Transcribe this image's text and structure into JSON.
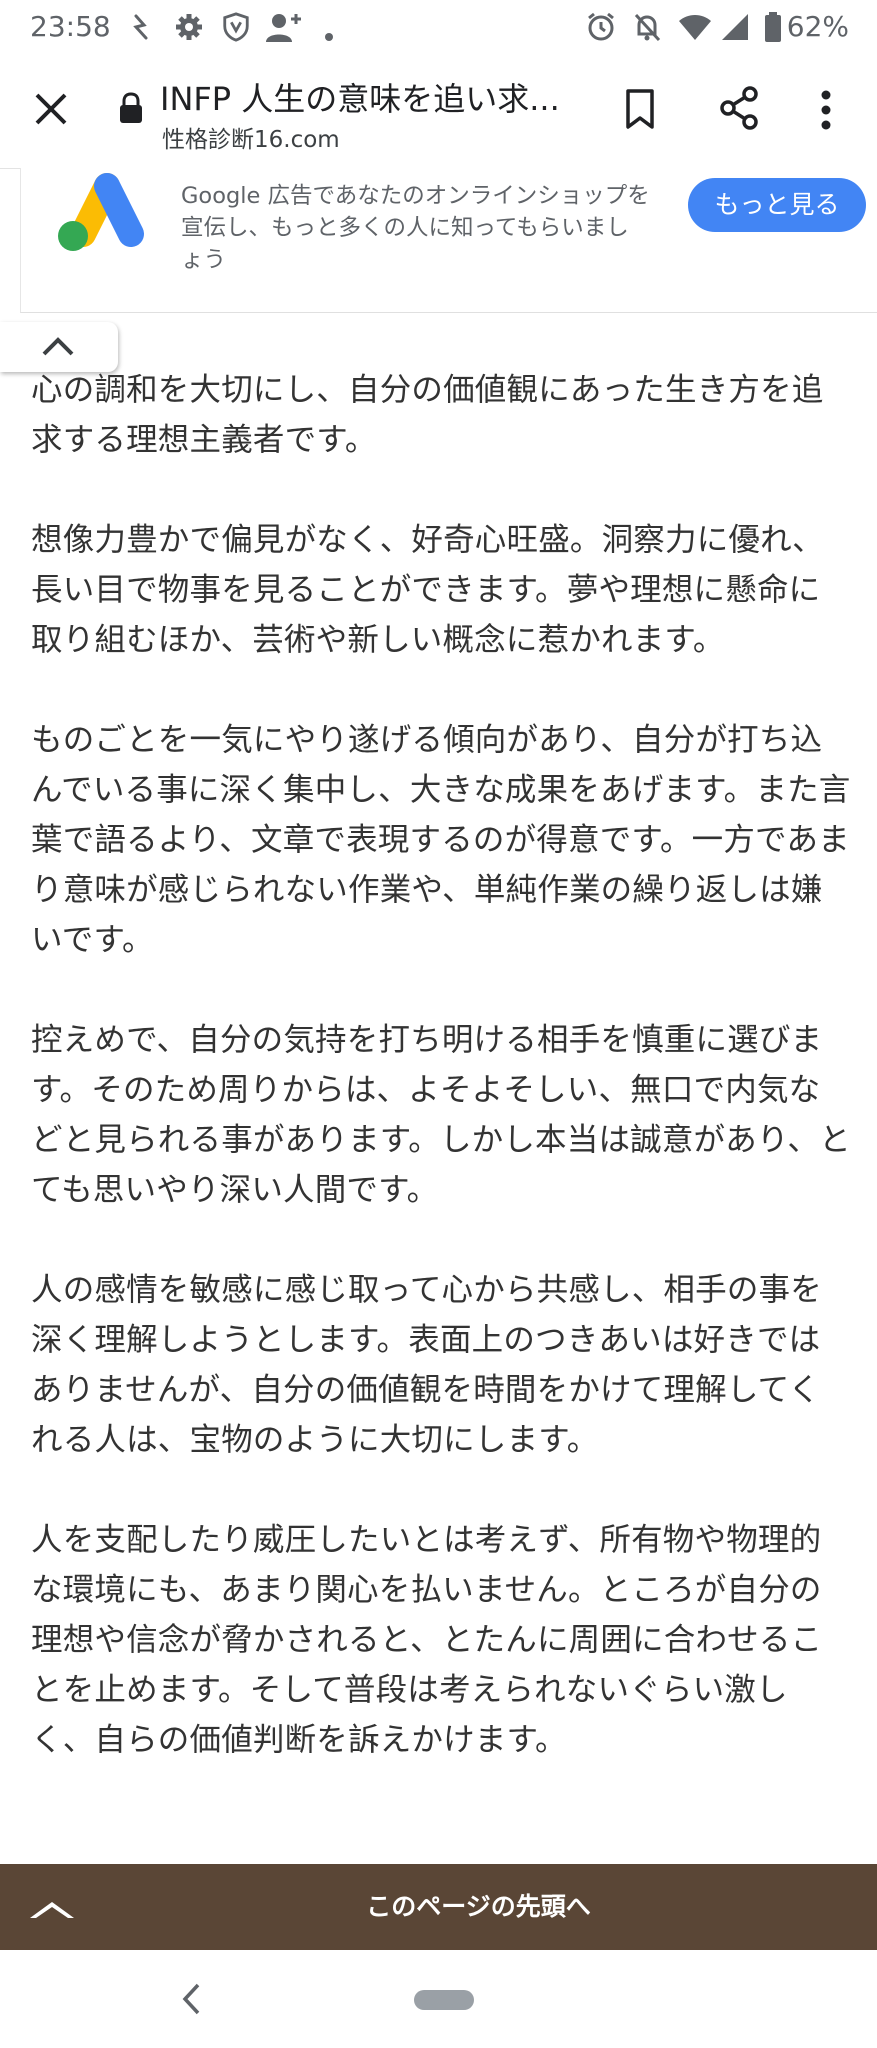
{
  "status_bar": {
    "time": "23:58",
    "battery": "62%",
    "icons": [
      "nfc-icon",
      "gear-icon",
      "shield-icon",
      "add-person-icon",
      "dot-icon",
      "alarm-icon",
      "bell-off-icon",
      "wifi-icon",
      "signal-icon",
      "battery-icon"
    ]
  },
  "toolbar": {
    "title": "INFP 人生の意味を追い求...",
    "url": "性格診断16.com",
    "icons": [
      "close-icon",
      "lock-icon",
      "bookmark-icon",
      "share-icon",
      "more-vert-icon"
    ]
  },
  "ad": {
    "text": "Google 広告であなたのオンラインショップを宣伝し、もっと多くの人に知ってもらいましょう",
    "button_label": "もっと見る",
    "colors": {
      "button": "#4285f4",
      "logo_blue": "#4285f4",
      "logo_yellow": "#fbbc04",
      "logo_green": "#34a853"
    }
  },
  "article": {
    "paragraphs": [
      "心の調和を大切にし、自分の価値観にあった生き方を追求する理想主義者です。",
      "想像力豊かで偏見がなく、好奇心旺盛。洞察力に優れ、長い目で物事を見ることができます。夢や理想に懸命に取り組むほか、芸術や新しい概念に惹かれます。",
      "ものごとを一気にやり遂げる傾向があり、自分が打ち込んでいる事に深く集中し、大きな成果をあげます。また言葉で語るより、文章で表現するのが得意です。一方であまり意味が感じられない作業や、単純作業の繰り返しは嫌いです。",
      "控えめで、自分の気持を打ち明ける相手を慎重に選びます。そのため周りからは、よそよそしい、無口で内気などと見られる事があります。しかし本当は誠意があり、とても思いやり深い人間です。",
      "人の感情を敏感に感じ取って心から共感し、相手の事を深く理解しようとします。表面上のつきあいは好きではありませんが、自分の価値観を時間をかけて理解してくれる人は、宝物のように大切にします。",
      "人を支配したり威圧したいとは考えず、所有物や物理的な環境にも、あまり関心を払いません。ところが自分の理想や信念が脅かされると、とたんに周囲に合わせることを止めます。そして普段は考えられないぐらい激しく、自らの価値判断を訴えかけます。"
    ]
  },
  "footer": {
    "back_to_top_label": "このページの先頭へ",
    "color": "#5a4636"
  },
  "nav_bar": {
    "icons": [
      "back-icon",
      "home-pill-icon"
    ]
  }
}
